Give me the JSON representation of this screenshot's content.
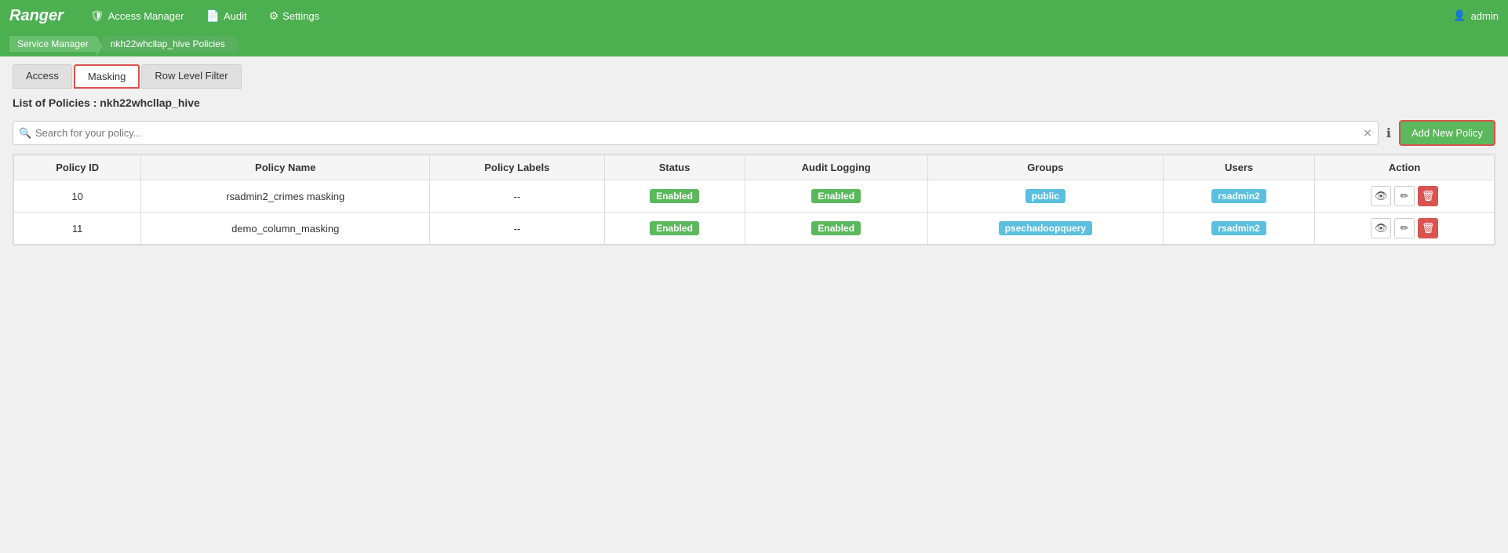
{
  "brand": "Ranger",
  "navbar": {
    "items": [
      {
        "icon": "🛡",
        "label": "Access Manager"
      },
      {
        "icon": "📄",
        "label": "Audit"
      },
      {
        "icon": "⚙",
        "label": "Settings"
      }
    ],
    "user": "admin"
  },
  "breadcrumb": {
    "items": [
      {
        "label": "Service Manager"
      },
      {
        "label": "nkh22whcllap_hive Policies"
      }
    ]
  },
  "tabs": [
    {
      "label": "Access",
      "active": false
    },
    {
      "label": "Masking",
      "active": true
    },
    {
      "label": "Row Level Filter",
      "active": false
    }
  ],
  "page_title": "List of Policies : nkh22whcllap_hive",
  "search": {
    "placeholder": "Search for your policy..."
  },
  "add_button_label": "Add New Policy",
  "table": {
    "headers": [
      "Policy ID",
      "Policy Name",
      "Policy Labels",
      "Status",
      "Audit Logging",
      "Groups",
      "Users",
      "Action"
    ],
    "rows": [
      {
        "id": "10",
        "name": "rsadmin2_crimes masking",
        "labels": "--",
        "status": "Enabled",
        "audit_logging": "Enabled",
        "groups": "public",
        "users": "rsadmin2"
      },
      {
        "id": "11",
        "name": "demo_column_masking",
        "labels": "--",
        "status": "Enabled",
        "audit_logging": "Enabled",
        "groups": "psechadoopquery",
        "users": "rsadmin2"
      }
    ]
  }
}
